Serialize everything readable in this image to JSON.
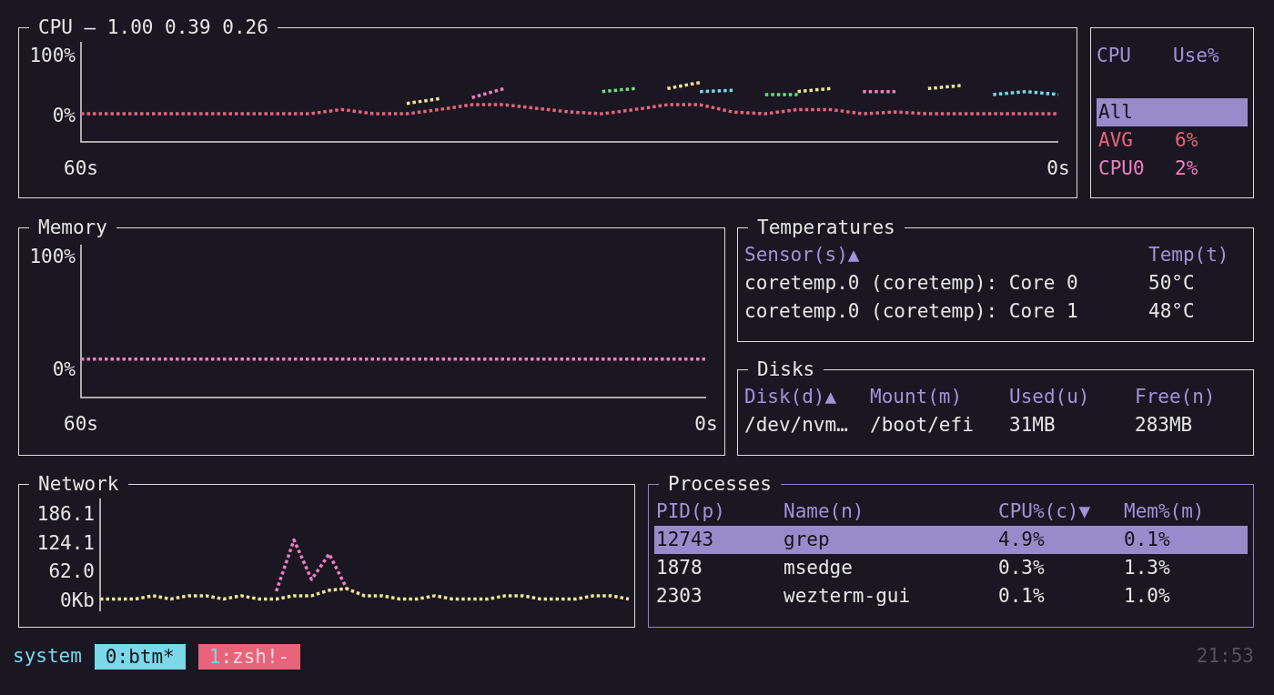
{
  "cpu": {
    "title": "CPU — 1.00 0.39 0.26",
    "selected": false,
    "chart_data": {
      "type": "line",
      "x": [
        60,
        58,
        56,
        54,
        52,
        50,
        48,
        46,
        44,
        42,
        40,
        38,
        36,
        34,
        32,
        30,
        28,
        26,
        24,
        22,
        20,
        18,
        16,
        14,
        12,
        10,
        8,
        6,
        4,
        2,
        0
      ],
      "xlim": [
        60,
        0
      ],
      "ylim": [
        -43.9,
        125.8
      ],
      "xticks": [
        {
          "value": 60,
          "label": "60s"
        },
        {
          "value": 0,
          "label": "0s"
        }
      ],
      "yticks": [
        {
          "value": 100,
          "label": "100%"
        },
        {
          "value": 0,
          "label": "0%"
        }
      ],
      "series": [
        {
          "color": "#e8647a",
          "line_style": "dotted",
          "values": [
            3,
            3,
            3,
            3,
            3,
            3,
            3,
            3,
            10,
            3,
            3,
            10,
            18,
            18,
            12,
            6,
            3,
            10,
            18,
            18,
            6,
            3,
            10,
            10,
            3,
            6,
            3,
            3,
            3,
            3,
            3
          ]
        },
        {
          "color": "#ef7fc0",
          "line_style": "dotted",
          "values": [
            null,
            null,
            null,
            null,
            null,
            null,
            null,
            null,
            null,
            null,
            null,
            null,
            30,
            45,
            null,
            null,
            null,
            null,
            null,
            null,
            null,
            null,
            null,
            null,
            40,
            40,
            null,
            null,
            null,
            null,
            null
          ]
        },
        {
          "color": "#f0e68c",
          "line_style": "dotted",
          "values": [
            null,
            null,
            null,
            null,
            null,
            null,
            null,
            null,
            null,
            null,
            20,
            28,
            null,
            null,
            null,
            null,
            null,
            null,
            45,
            55,
            null,
            null,
            40,
            45,
            null,
            null,
            45,
            50,
            null,
            null,
            null
          ]
        },
        {
          "color": "#6be07a",
          "line_style": "dotted",
          "values": [
            null,
            null,
            null,
            null,
            null,
            null,
            null,
            null,
            null,
            null,
            null,
            null,
            null,
            null,
            null,
            null,
            40,
            45,
            null,
            null,
            null,
            35,
            35,
            null,
            null,
            null,
            null,
            null,
            null,
            null,
            null
          ]
        },
        {
          "color": "#7ad8e8",
          "line_style": "dotted",
          "values": [
            null,
            null,
            null,
            null,
            null,
            null,
            null,
            null,
            null,
            null,
            null,
            null,
            null,
            null,
            null,
            null,
            null,
            null,
            null,
            40,
            42,
            null,
            null,
            null,
            null,
            null,
            null,
            null,
            35,
            40,
            35
          ]
        }
      ]
    }
  },
  "cpu_legend": {
    "selected": false,
    "columns": [
      "CPU",
      "Use%"
    ],
    "rows": [
      {
        "name": "All",
        "selected": true
      },
      {
        "name": "AVG",
        "value": "6%",
        "color": "#e8647a",
        "selected": false
      },
      {
        "name": "CPU0",
        "value": "2%",
        "color": "#ef7fc0",
        "selected": false
      }
    ]
  },
  "memory": {
    "title": "Memory",
    "selected": false,
    "chart_data": {
      "type": "line",
      "x": [
        60,
        0
      ],
      "xlim": [
        60,
        0
      ],
      "ylim": [
        -25,
        110.5
      ],
      "xticks": [
        {
          "value": 60,
          "label": "60s"
        },
        {
          "value": 0,
          "label": "0s"
        }
      ],
      "yticks": [
        {
          "value": 100,
          "label": "100%"
        },
        {
          "value": 0,
          "label": "0%"
        }
      ],
      "series": [
        {
          "color": "#ef7fc0",
          "line_style": "dotted",
          "values": [
            9,
            9
          ]
        }
      ]
    }
  },
  "temperatures": {
    "title": "Temperatures",
    "selected": false,
    "columns": [
      "Sensor(s)▲",
      "Temp(t)"
    ],
    "rows": [
      [
        "coretemp.0 (coretemp): Core 0",
        "50°C"
      ],
      [
        "coretemp.0 (coretemp): Core 1",
        "48°C"
      ]
    ]
  },
  "disks": {
    "title": "Disks",
    "selected": false,
    "columns": [
      "Disk(d)▲",
      "Mount(m)",
      "Used(u)",
      "Free(n)"
    ],
    "rows": [
      [
        "/dev/nvm…",
        "/boot/efi",
        "31MB",
        "283MB"
      ]
    ]
  },
  "network": {
    "title": "Network",
    "selected": false,
    "chart_data": {
      "type": "line",
      "ylim": [
        -23.5,
        219.4
      ],
      "yticks": [
        {
          "value": 186.1,
          "label": "186.1"
        },
        {
          "value": 124.1,
          "label": "124.1"
        },
        {
          "value": 62,
          "label": "62.0"
        },
        {
          "value": 0,
          "label": "0Kb"
        }
      ],
      "series": [
        {
          "color": "#f0e68c",
          "line_style": "dotted",
          "values": [
            3,
            3,
            3,
            10,
            3,
            10,
            10,
            3,
            10,
            3,
            3,
            10,
            10,
            22,
            25,
            10,
            10,
            3,
            3,
            10,
            3,
            3,
            3,
            10,
            10,
            3,
            3,
            3,
            10,
            10,
            3
          ]
        },
        {
          "color": "#ef7fc0",
          "line_style": "dotted",
          "values": [
            null,
            null,
            null,
            null,
            null,
            null,
            null,
            null,
            null,
            null,
            20,
            130,
            45,
            100,
            25,
            null,
            null,
            null,
            null,
            null,
            null,
            null,
            null,
            null,
            null,
            null,
            null,
            null,
            null,
            null,
            null
          ]
        }
      ]
    }
  },
  "processes": {
    "title": "Processes",
    "selected": true,
    "columns": [
      "PID(p)",
      "Name(n)",
      "CPU%(c)▼",
      "Mem%(m)"
    ],
    "rows": [
      {
        "cells": [
          "12743",
          "grep",
          "4.9%",
          "0.1%"
        ],
        "selected": true
      },
      {
        "cells": [
          "1878",
          "msedge",
          "0.3%",
          "1.3%"
        ],
        "selected": false
      },
      {
        "cells": [
          "2303",
          "wezterm-gui",
          "0.1%",
          "1.0%"
        ],
        "selected": false
      }
    ]
  },
  "status_bar": {
    "session": "system",
    "tabs": [
      {
        "index": "0",
        "name": ":btm*",
        "selected": true
      },
      {
        "index": "1",
        "name": ":zsh!-",
        "selected": false
      }
    ],
    "clock": "21:53"
  }
}
